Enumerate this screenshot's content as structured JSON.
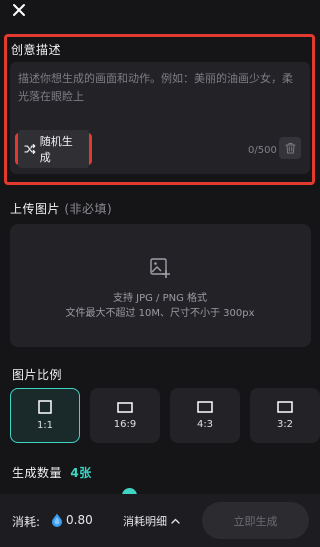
{
  "creative": {
    "title": "创意描述",
    "placeholder": "描述你想生成的画面和动作。例如：美丽的油画少女，柔光落在眼睑上",
    "random_label": "随机生成",
    "char_count": "0/500"
  },
  "upload": {
    "title": "上传图片",
    "optional": "(非必填)",
    "line1": "支持 JPG / PNG 格式",
    "line2": "文件最大不超过 10M、尺寸不小于 300px"
  },
  "ratio": {
    "title": "图片比例",
    "options": [
      {
        "label": "1:1",
        "selected": true
      },
      {
        "label": "16:9",
        "selected": false
      },
      {
        "label": "4:3",
        "selected": false
      },
      {
        "label": "3:2",
        "selected": false
      }
    ]
  },
  "count": {
    "title": "生成数量",
    "value": "4张"
  },
  "bottom": {
    "cost_label": "消耗:",
    "cost_value": "0.80",
    "cost_detail": "消耗明细",
    "generate_label": "立即生成"
  },
  "colors": {
    "accent": "#3fd5c4",
    "highlight": "#e23a2e"
  }
}
